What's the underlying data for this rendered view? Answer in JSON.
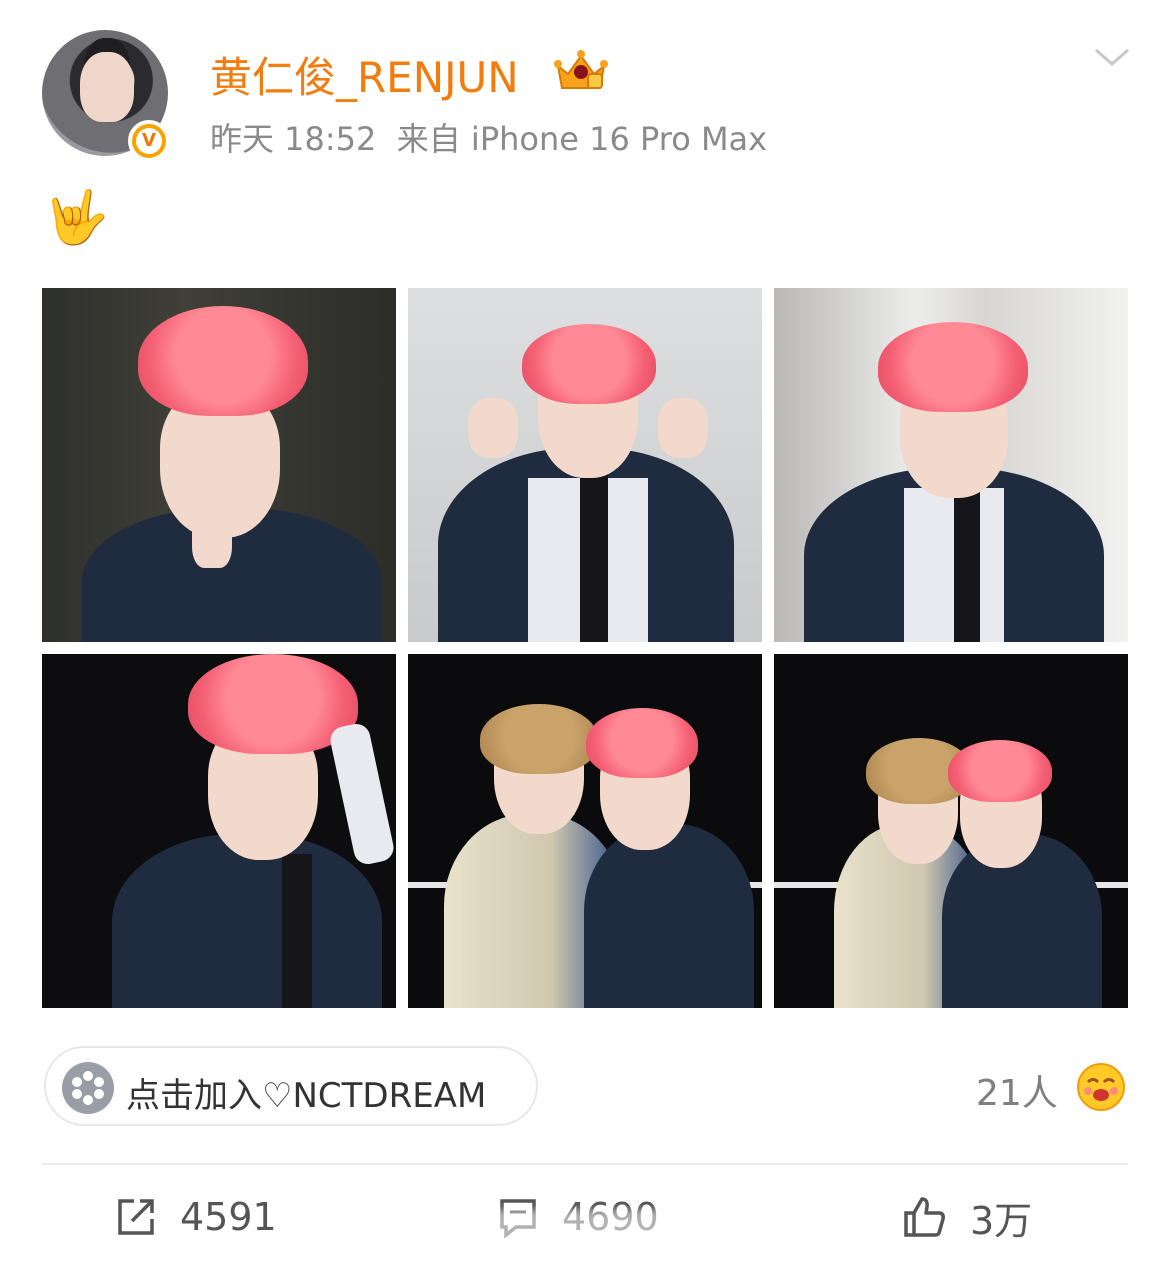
{
  "post": {
    "author": "黄仁俊_RENJUN",
    "time": "昨天 18:52",
    "source": "来自 iPhone 16 Pro Max",
    "content_emoji": "🤟",
    "photo_count": 6
  },
  "group": {
    "label": "点击加入♡NCTDREAM"
  },
  "reactions": {
    "count": "21人"
  },
  "actions": {
    "repost": "4591",
    "comment": "4690",
    "like": "3万"
  },
  "colors": {
    "username": "#f37c0e",
    "meta": "#8a8a8a",
    "verified_badge": "#f7a400"
  }
}
